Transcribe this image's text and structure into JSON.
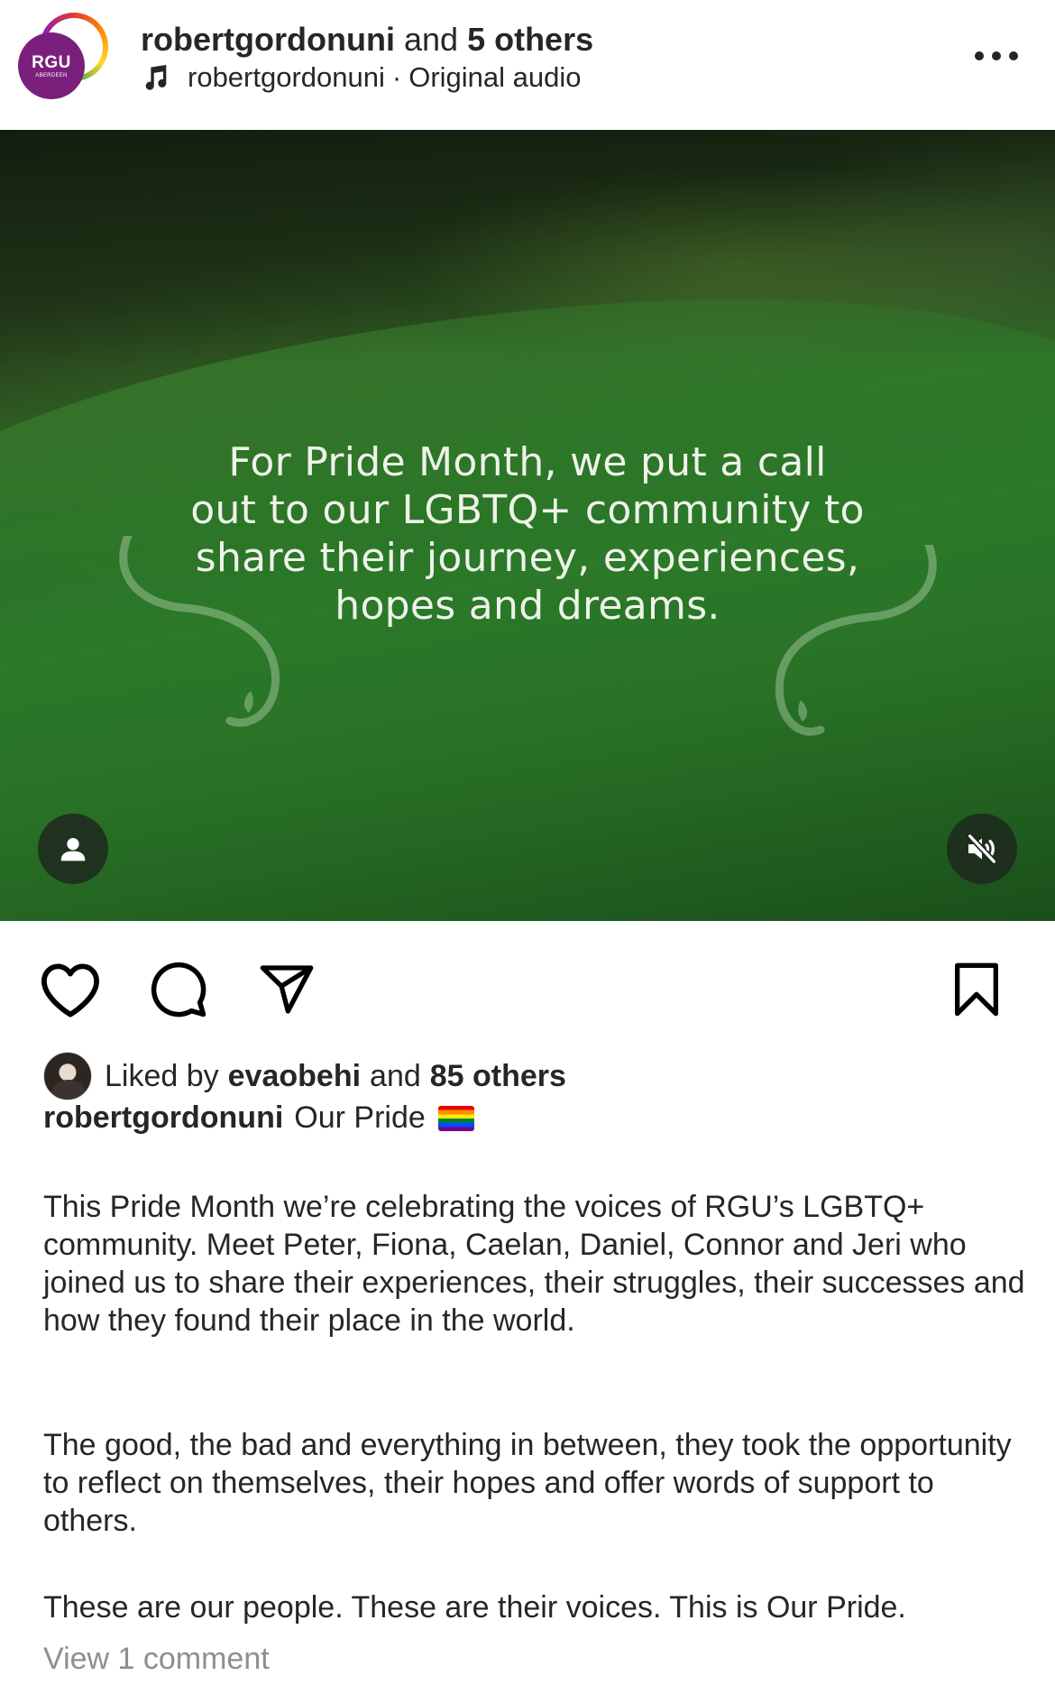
{
  "header": {
    "avatar_logo": "RGU",
    "avatar_sub": "ABERDEEN",
    "username": "robertgordonuni",
    "and_word": "and",
    "collaborators": "5 others",
    "audio_user": "robertgordonuni",
    "audio_sep": "·",
    "audio_title": "Original audio"
  },
  "media": {
    "overlay_line1": "For Pride Month, we put a call",
    "overlay_line2": "out to our LGBTQ+ community to",
    "overlay_line3": "share their journey, experiences,",
    "overlay_line4": "hopes and dreams."
  },
  "likes": {
    "prefix": "Liked by",
    "liker": "evaobehi",
    "and_word": "and",
    "others": "85 others"
  },
  "caption": {
    "username": "robertgordonuni",
    "title": "Our Pride",
    "para1": "This Pride Month we’re celebrating the voices of RGU’s LGBTQ+ community. Meet Peter, Fiona, Caelan, Daniel, Connor and Jeri who joined us to share their experiences, their struggles, their successes and how they found their place in the world.",
    "para2": "The good, the bad and everything in between, they took the opportunity to reflect on themselves, their hopes and offer words of support to others.",
    "para3": "These are our people. These are their voices. This is Our Pride."
  },
  "comments": {
    "view_label": "View 1 comment"
  },
  "icons": {
    "music": "music-note-icon",
    "more": "more-horizontal-icon",
    "tagged": "person-icon",
    "mute": "muted-speaker-icon",
    "like": "heart-icon",
    "comment": "comment-bubble-icon",
    "share": "paper-plane-icon",
    "save": "bookmark-icon",
    "pride": "rainbow-flag-icon"
  },
  "colors": {
    "brand_purple": "#7b1f7d",
    "text": "#262626",
    "muted": "#8e8e8e"
  }
}
